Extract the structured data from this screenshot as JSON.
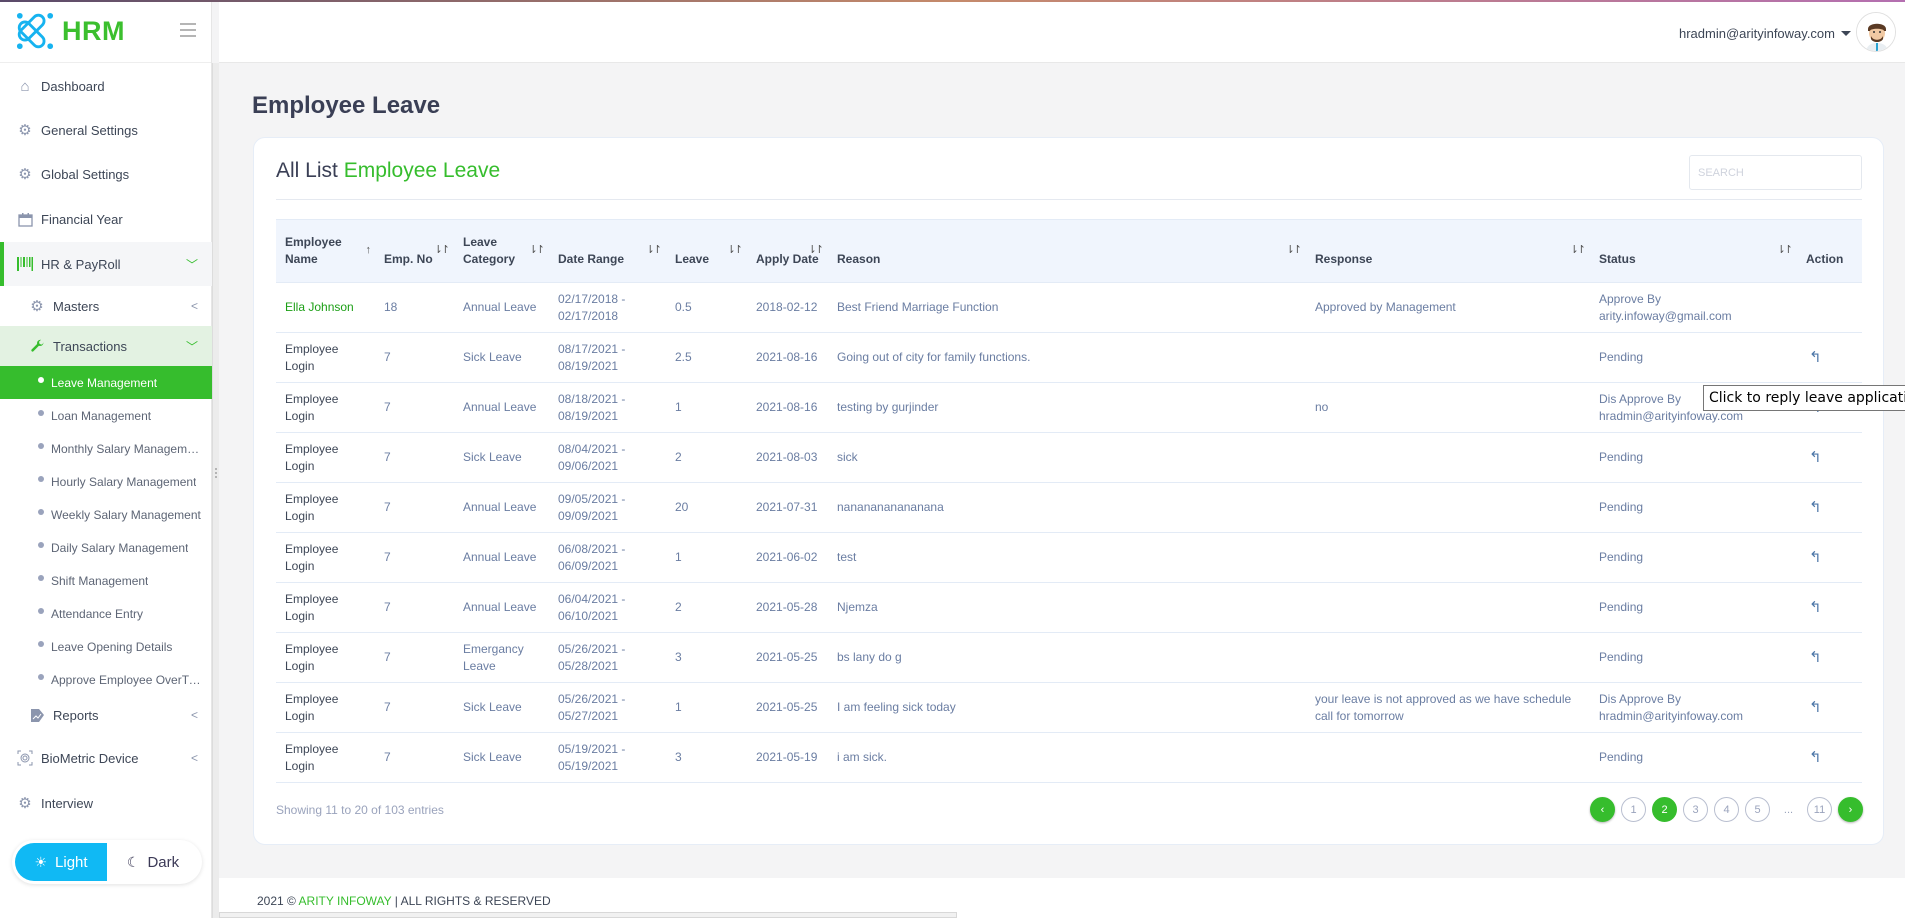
{
  "app": {
    "logo_text": "HRM",
    "brand_color": "#36bd2d",
    "accent_color": "#10b9f4"
  },
  "header": {
    "user_email": "hradmin@arityinfoway.com"
  },
  "sidebar": {
    "items": [
      {
        "label": "Dashboard",
        "icon": "home-icon"
      },
      {
        "label": "General Settings",
        "icon": "gear-icon"
      },
      {
        "label": "Global Settings",
        "icon": "gear-icon"
      },
      {
        "label": "Financial Year",
        "icon": "calendar-icon"
      },
      {
        "label": "HR & PayRoll",
        "icon": "barcode-icon"
      }
    ],
    "hr_sub": {
      "masters": "Masters",
      "transactions": "Transactions",
      "reports": "Reports"
    },
    "transactions_items": [
      "Leave Management",
      "Loan Management",
      "Monthly Salary Management",
      "Hourly Salary Management",
      "Weekly Salary Management",
      "Daily Salary Management",
      "Shift Management",
      "Attendance Entry",
      "Leave Opening Details",
      "Approve Employee OverTime"
    ],
    "bottom_items": [
      {
        "label": "BioMetric Device",
        "icon": "fingerprint-icon"
      },
      {
        "label": "Interview",
        "icon": "gear-icon"
      }
    ],
    "theme": {
      "light": "Light",
      "dark": "Dark",
      "selected": "Light"
    }
  },
  "main": {
    "page_title": "Employee Leave",
    "card_title_prefix": "All List",
    "card_title_highlight": "Employee Leave",
    "search_placeholder": "SEARCH",
    "table": {
      "columns": [
        "Employee Name",
        "Emp. No",
        "Leave Category",
        "Date Range",
        "Leave",
        "Apply Date",
        "Reason",
        "Response",
        "Status",
        "Action"
      ],
      "rows": [
        {
          "name": "Ella Johnson",
          "emp_no": "18",
          "category": "Annual Leave",
          "date_from": "02/17/2018 -",
          "date_to": "02/17/2018",
          "leave": "0.5",
          "apply_date": "2018-02-12",
          "reason": "Best Friend Marriage Function",
          "response": "Approved by Management",
          "status_line1": "Approve By",
          "status_line2": "arity.infoway@gmail.com",
          "has_reply": false
        },
        {
          "name": "Employee Login",
          "emp_no": "7",
          "category": "Sick Leave",
          "date_from": "08/17/2021 -",
          "date_to": "08/19/2021",
          "leave": "2.5",
          "apply_date": "2021-08-16",
          "reason": "Going out of city for family functions.",
          "response": "",
          "status_line1": "Pending",
          "status_line2": "",
          "has_reply": true
        },
        {
          "name": "Employee Login",
          "emp_no": "7",
          "category": "Annual Leave",
          "date_from": "08/18/2021 -",
          "date_to": "08/19/2021",
          "leave": "1",
          "apply_date": "2021-08-16",
          "reason": "testing by gurjinder",
          "response": "no",
          "status_line1": "Dis Approve By",
          "status_line2": "hradmin@arityinfoway.com",
          "has_reply": true
        },
        {
          "name": "Employee Login",
          "emp_no": "7",
          "category": "Sick Leave",
          "date_from": "08/04/2021 -",
          "date_to": "09/06/2021",
          "leave": "2",
          "apply_date": "2021-08-03",
          "reason": "sick",
          "response": "",
          "status_line1": "Pending",
          "status_line2": "",
          "has_reply": true
        },
        {
          "name": "Employee Login",
          "emp_no": "7",
          "category": "Annual Leave",
          "date_from": "09/05/2021 -",
          "date_to": "09/09/2021",
          "leave": "20",
          "apply_date": "2021-07-31",
          "reason": "nananananananana",
          "response": "",
          "status_line1": "Pending",
          "status_line2": "",
          "has_reply": true
        },
        {
          "name": "Employee Login",
          "emp_no": "7",
          "category": "Annual Leave",
          "date_from": "06/08/2021 -",
          "date_to": "06/09/2021",
          "leave": "1",
          "apply_date": "2021-06-02",
          "reason": "test",
          "response": "",
          "status_line1": "Pending",
          "status_line2": "",
          "has_reply": true
        },
        {
          "name": "Employee Login",
          "emp_no": "7",
          "category": "Annual Leave",
          "date_from": "06/04/2021 -",
          "date_to": "06/10/2021",
          "leave": "2",
          "apply_date": "2021-05-28",
          "reason": "Njemza",
          "response": "",
          "status_line1": "Pending",
          "status_line2": "",
          "has_reply": true
        },
        {
          "name": "Employee Login",
          "emp_no": "7",
          "category": "Emergancy Leave",
          "date_from": "05/26/2021 -",
          "date_to": "05/28/2021",
          "leave": "3",
          "apply_date": "2021-05-25",
          "reason": "bs lany do g",
          "response": "",
          "status_line1": "Pending",
          "status_line2": "",
          "has_reply": true
        },
        {
          "name": "Employee Login",
          "emp_no": "7",
          "category": "Sick Leave",
          "date_from": "05/26/2021 -",
          "date_to": "05/27/2021",
          "leave": "1",
          "apply_date": "2021-05-25",
          "reason": "I am feeling sick today",
          "response": "your leave is not approved as we have schedule call for tomorrow",
          "status_line1": "Dis Approve By",
          "status_line2": "hradmin@arityinfoway.com",
          "has_reply": true
        },
        {
          "name": "Employee Login",
          "emp_no": "7",
          "category": "Sick Leave",
          "date_from": "05/19/2021 -",
          "date_to": "05/19/2021",
          "leave": "3",
          "apply_date": "2021-05-19",
          "reason": "i am sick.",
          "response": "",
          "status_line1": "Pending",
          "status_line2": "",
          "has_reply": true
        }
      ]
    },
    "entries_info": "Showing 11 to 20 of 103 entries",
    "pagination": {
      "pages": [
        "1",
        "2",
        "3",
        "4",
        "5"
      ],
      "ellipsis": "...",
      "last": "11",
      "current": "2"
    },
    "tooltip": "Click to reply leave application"
  },
  "footer": {
    "prefix": "2021 ©",
    "company": "ARITY INFOWAY",
    "suffix": "| ALL RIGHTS & RESERVED"
  }
}
